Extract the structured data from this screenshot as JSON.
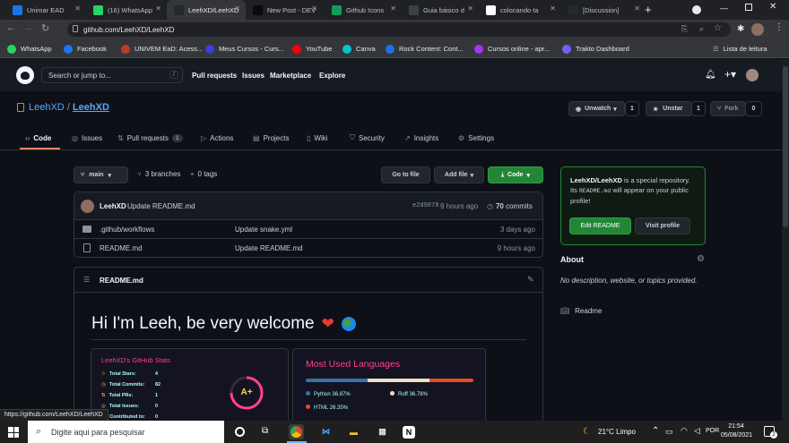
{
  "browser": {
    "tabs": [
      {
        "label": "Unimar EAD",
        "icon": "unimar-icon",
        "color": "#1a73e8"
      },
      {
        "label": "(16) WhatsApp",
        "icon": "whatsapp-icon",
        "color": "#25d366"
      },
      {
        "label": "LeehXD/LeehXD",
        "icon": "github-icon",
        "color": "#24292e"
      },
      {
        "label": "New Post - DEV",
        "icon": "dev-icon",
        "color": "#0a0a0a"
      },
      {
        "label": "Github Icons",
        "icon": "docs-icon",
        "color": "#0f9d58"
      },
      {
        "label": "Guia básico d",
        "icon": "guide-icon",
        "color": "#3c4043"
      },
      {
        "label": "colocando ta",
        "icon": "google-icon",
        "color": "#ffffff"
      },
      {
        "label": "[Discussion]",
        "icon": "github-icon",
        "color": "#24292e"
      }
    ],
    "url": "github.com/LeehXD/LeehXD",
    "bookmarks": [
      {
        "label": "WhatsApp",
        "color": "#25d366"
      },
      {
        "label": "Facebook",
        "color": "#1877f2"
      },
      {
        "label": "UNIVEM EaD: Acess...",
        "color": "#c0392b"
      },
      {
        "label": "Meus Cursos - Curs...",
        "color": "#3b3fd8"
      },
      {
        "label": "YouTube",
        "color": "#ff0000"
      },
      {
        "label": "Canva",
        "color": "#00c4cc"
      },
      {
        "label": "Rock Content: Cont...",
        "color": "#1a73e8"
      },
      {
        "label": "Cursos online - apr...",
        "color": "#a435f0"
      },
      {
        "label": "Trakto Dashboard",
        "color": "#6c63ff"
      }
    ],
    "reading_list": "Lista de leitura",
    "status_url": "https://github.com/LeehXD/LeehXD"
  },
  "github": {
    "search_placeholder": "Search or jump to...",
    "search_key": "/",
    "nav": [
      "Pull requests",
      "Issues",
      "Marketplace",
      "Explore"
    ]
  },
  "repo": {
    "owner": "LeehXD",
    "name": "LeehXD",
    "unwatch": "Unwatch",
    "unwatch_count": "1",
    "unstar": "Unstar",
    "unstar_count": "1",
    "fork": "Fork",
    "fork_count": "0",
    "tabs": [
      {
        "label": "Code",
        "icon": "code-icon"
      },
      {
        "label": "Issues",
        "icon": "issue-icon"
      },
      {
        "label": "Pull requests",
        "icon": "pull-request-icon",
        "badge": "1"
      },
      {
        "label": "Actions",
        "icon": "play-icon"
      },
      {
        "label": "Projects",
        "icon": "project-icon"
      },
      {
        "label": "Wiki",
        "icon": "book-icon"
      },
      {
        "label": "Security",
        "icon": "shield-icon"
      },
      {
        "label": "Insights",
        "icon": "graph-icon"
      },
      {
        "label": "Settings",
        "icon": "gear-icon"
      }
    ],
    "branch": "main",
    "branches": "3 branches",
    "tags": "0 tags",
    "go_to_file": "Go to file",
    "add_file": "Add file",
    "code_btn": "Code",
    "commit": {
      "author": "LeehXD",
      "message": "Update README.md",
      "hash": "e2d9878",
      "time": "9 hours ago",
      "count": "70",
      "count_label": "commits"
    },
    "files": [
      {
        "name": ".github/workflows",
        "message": "Update snake.yml",
        "time": "3 days ago",
        "type": "folder"
      },
      {
        "name": "README.md",
        "message": "Update README.md",
        "time": "9 hours ago",
        "type": "file"
      }
    ],
    "readme_title": "README.md",
    "readme_heading": "Hi I'm Leeh, be very welcome",
    "stats": {
      "title": "LeehXD's GitHub Stats",
      "rows": [
        {
          "label": "Total Stars:",
          "value": "4"
        },
        {
          "label": "Total Commits:",
          "value": "82"
        },
        {
          "label": "Total PRs:",
          "value": "1"
        },
        {
          "label": "Total Issues:",
          "value": "0"
        },
        {
          "label": "Contributed to:",
          "value": "0"
        }
      ],
      "grade": "A+"
    },
    "languages": {
      "title": "Most Used Languages",
      "items": [
        {
          "name": "Python",
          "percent": "36.87%",
          "color": "#3572a5",
          "value": 36.87
        },
        {
          "name": "Roff",
          "percent": "36.78%",
          "color": "#ecdebe",
          "value": 36.78
        },
        {
          "name": "HTML",
          "percent": "26.35%",
          "color": "#e34c26",
          "value": 26.35
        }
      ]
    },
    "special": {
      "repo": "LeehXD/LeehXD",
      "text1": " is a special repository.",
      "text2a": "Its ",
      "file": "README.md",
      "text2b": " will appear on your public profile!",
      "edit": "Edit README",
      "visit": "Visit profile"
    },
    "about": {
      "title": "About",
      "description": "No description, website, or topics provided.",
      "readme": "Readme"
    }
  },
  "taskbar": {
    "search": "Digite aqui para pesquisar",
    "weather": "21°C  Limpo",
    "time": "21:54",
    "date": "05/08/2021",
    "notifications": "2"
  }
}
